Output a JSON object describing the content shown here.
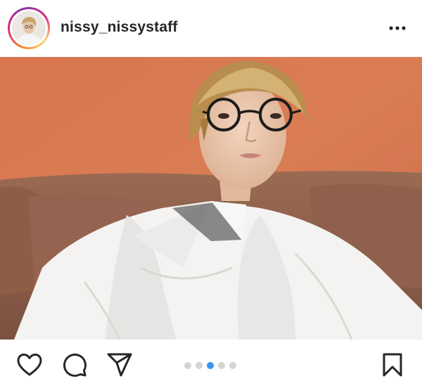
{
  "post": {
    "username": "nissy_nissystaff",
    "carousel": {
      "total": 5,
      "active_index": 2
    }
  },
  "icons": {
    "more": "more-horizontal-icon",
    "like": "heart-icon",
    "comment": "comment-icon",
    "share": "paper-plane-icon",
    "save": "bookmark-icon"
  },
  "colors": {
    "active_dot": "#3897f0",
    "inactive_dot": "#d4d4d4",
    "text": "#262626",
    "avatar_ring_start": "#f58529",
    "avatar_ring_end": "#dd2a7b"
  }
}
